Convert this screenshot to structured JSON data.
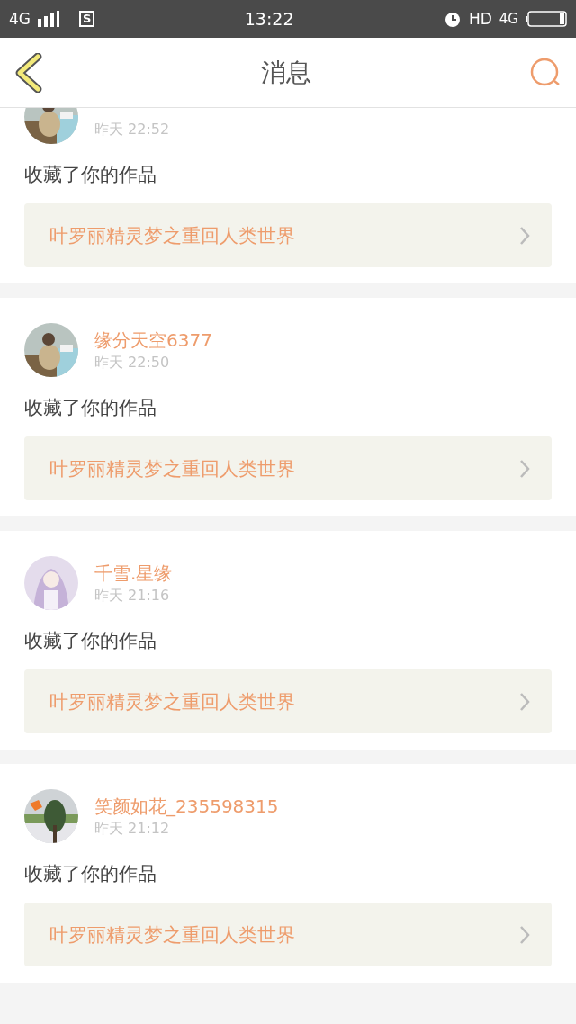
{
  "status_bar": {
    "network": "4G",
    "sim_label": "S",
    "time": "13:22",
    "hd": "HD",
    "data": "4G"
  },
  "header": {
    "title": "消息"
  },
  "messages": [
    {
      "time": "昨天 22:52",
      "action": "收藏了你的作品",
      "work": "叶罗丽精灵梦之重回人类世界"
    },
    {
      "name": "缘分天空6377",
      "time": "昨天 22:50",
      "action": "收藏了你的作品",
      "work": "叶罗丽精灵梦之重回人类世界"
    },
    {
      "name": "千雪.星缘",
      "time": "昨天 21:16",
      "action": "收藏了你的作品",
      "work": "叶罗丽精灵梦之重回人类世界"
    },
    {
      "name": "笑颜如花_235598315",
      "time": "昨天 21:12",
      "action": "收藏了你的作品",
      "work": "叶罗丽精灵梦之重回人类世界"
    }
  ]
}
